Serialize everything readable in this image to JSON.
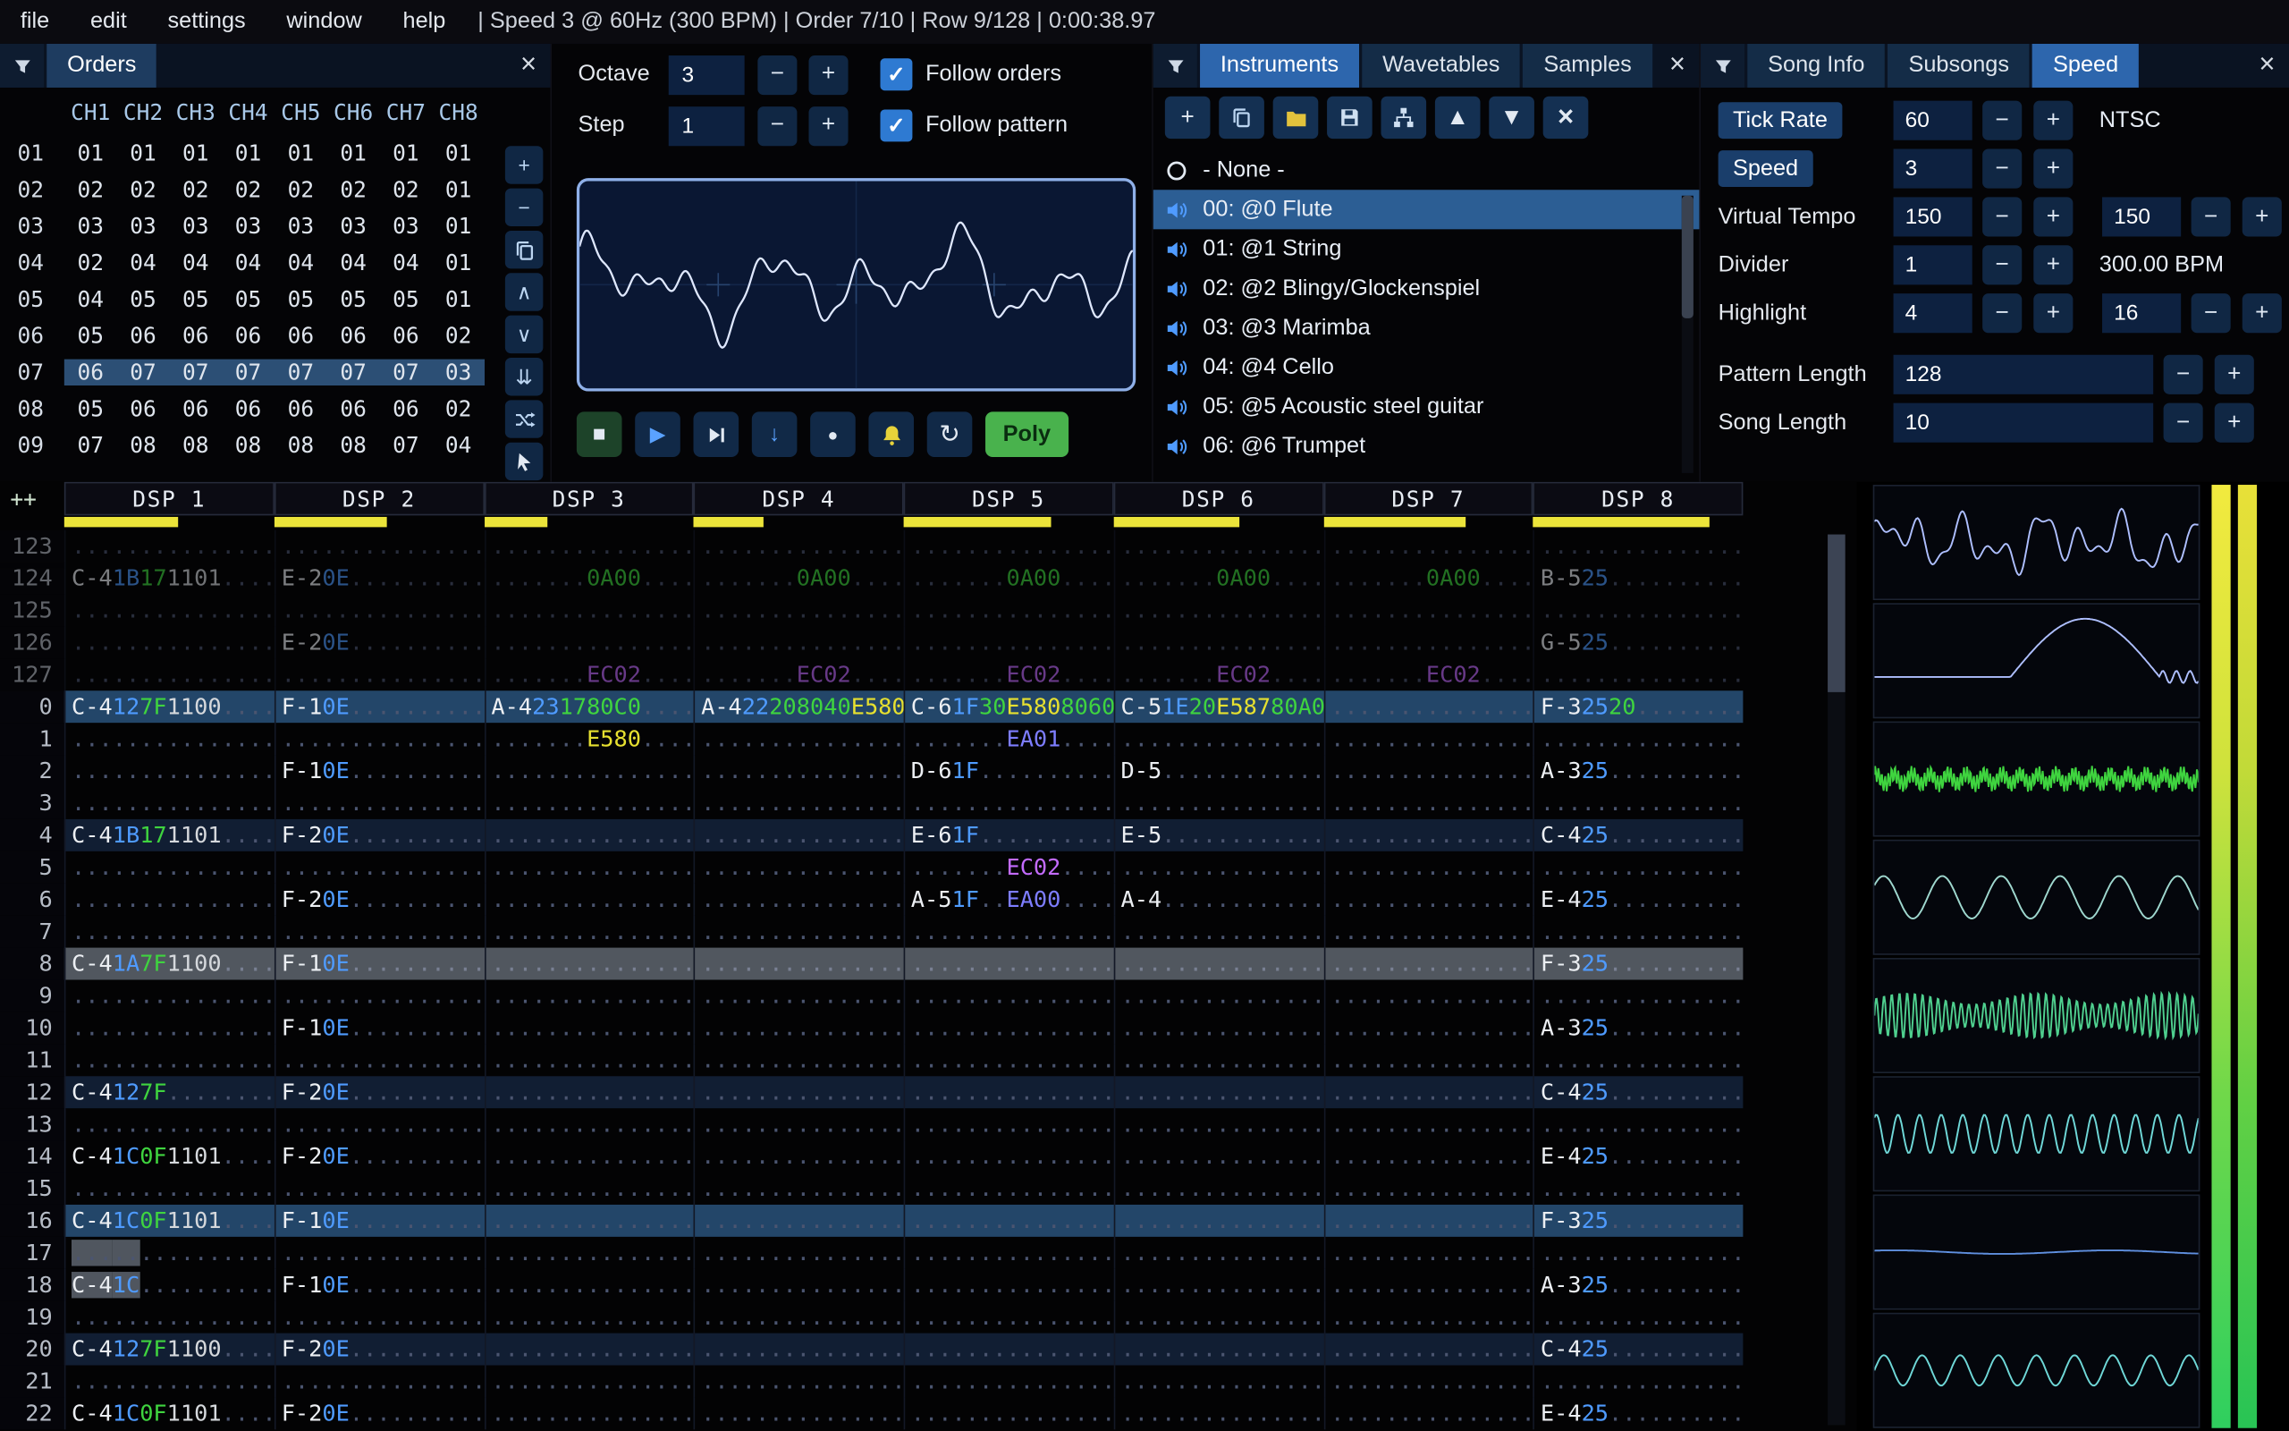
{
  "colors": {
    "accent": "#4f9bff",
    "tab_active": "#2d66ad",
    "note": "#e8e8e8",
    "instrument": "#4f9bff",
    "volume": "#3fd43f",
    "fx_pitch": "#e6e030",
    "fx_misc": "#c36bff",
    "fx_pan": "#3fd43f",
    "fx_legato": "#7d7dff",
    "channel_meter": "#ece43a",
    "highlight_row": "#234669",
    "cursor_row": "#51575f"
  },
  "icons": {
    "plus": "+",
    "minus": "−",
    "chevron-up": "∧",
    "chevron-down": "∨",
    "double-chevron-down": "⇊",
    "triangle-up": "▲",
    "triangle-down": "▼",
    "close": "×",
    "stop": "■",
    "play": "▶",
    "arrow-down": "↓",
    "record": "●",
    "repeat": "↻",
    "check": "✓"
  },
  "menu": {
    "items": [
      "file",
      "edit",
      "settings",
      "window",
      "help"
    ],
    "status": "| Speed 3 @ 60Hz (300 BPM) | Order 7/10 | Row 9/128 | 0:00:38.97"
  },
  "orders": {
    "title": "Orders",
    "channel_headers": [
      "CH1",
      "CH2",
      "CH3",
      "CH4",
      "CH5",
      "CH6",
      "CH7",
      "CH8"
    ],
    "rows": [
      {
        "label": "01",
        "selected": false,
        "values": [
          "01",
          "01",
          "01",
          "01",
          "01",
          "01",
          "01",
          "01"
        ]
      },
      {
        "label": "02",
        "selected": false,
        "values": [
          "02",
          "02",
          "02",
          "02",
          "02",
          "02",
          "02",
          "01"
        ]
      },
      {
        "label": "03",
        "selected": false,
        "values": [
          "03",
          "03",
          "03",
          "03",
          "03",
          "03",
          "03",
          "01"
        ]
      },
      {
        "label": "04",
        "selected": false,
        "values": [
          "02",
          "04",
          "04",
          "04",
          "04",
          "04",
          "04",
          "01"
        ]
      },
      {
        "label": "05",
        "selected": false,
        "values": [
          "04",
          "05",
          "05",
          "05",
          "05",
          "05",
          "05",
          "01"
        ]
      },
      {
        "label": "06",
        "selected": false,
        "values": [
          "05",
          "06",
          "06",
          "06",
          "06",
          "06",
          "06",
          "02"
        ]
      },
      {
        "label": "07",
        "selected": true,
        "values": [
          "06",
          "07",
          "07",
          "07",
          "07",
          "07",
          "07",
          "03"
        ]
      },
      {
        "label": "08",
        "selected": false,
        "values": [
          "05",
          "06",
          "06",
          "06",
          "06",
          "06",
          "06",
          "02"
        ]
      },
      {
        "label": "09",
        "selected": false,
        "values": [
          "07",
          "08",
          "08",
          "08",
          "08",
          "08",
          "07",
          "04"
        ]
      }
    ],
    "toolbar": [
      {
        "name": "add-order-button",
        "icon": "plus"
      },
      {
        "name": "remove-order-button",
        "icon": "minus"
      },
      {
        "name": "duplicate-order-button",
        "icon": "copy"
      },
      {
        "name": "move-order-up-button",
        "icon": "chevron-up"
      },
      {
        "name": "move-order-down-button",
        "icon": "chevron-down"
      },
      {
        "name": "duplicate-order-to-end-button",
        "icon": "double-chevron-down"
      },
      {
        "name": "order-change-mode-button",
        "icon": "shuffle"
      },
      {
        "name": "order-edit-mode-button",
        "icon": "cursor"
      }
    ]
  },
  "transport": {
    "octave_label": "Octave",
    "octave": "3",
    "step_label": "Step",
    "step": "1",
    "follow_orders_label": "Follow orders",
    "follow_pattern_label": "Follow pattern",
    "poly_label": "Poly",
    "buttons": [
      {
        "name": "stop-button",
        "icon": "stop"
      },
      {
        "name": "play-button",
        "icon": "play"
      },
      {
        "name": "play-pattern-button",
        "icon": "next"
      },
      {
        "name": "step-one-row-button",
        "icon": "arrow-down"
      },
      {
        "name": "record-button",
        "icon": "record"
      },
      {
        "name": "metronome-button",
        "icon": "bell"
      },
      {
        "name": "repeat-pattern-button",
        "icon": "repeat"
      }
    ]
  },
  "instruments": {
    "tabs": [
      "Instruments",
      "Wavetables",
      "Samples"
    ],
    "none_label": "- None -",
    "selected": 0,
    "items": [
      "00: @0 Flute",
      "01: @1 String",
      "02: @2 Blingy/Glockenspiel",
      "03: @3 Marimba",
      "04: @4 Cello",
      "05: @5 Acoustic steel guitar",
      "06: @6 Trumpet"
    ],
    "toolbar": [
      {
        "name": "add-instrument-button",
        "icon": "plus"
      },
      {
        "name": "duplicate-instrument-button",
        "icon": "copy"
      },
      {
        "name": "open-instrument-button",
        "icon": "folder"
      },
      {
        "name": "save-instrument-button",
        "icon": "save"
      },
      {
        "name": "instrument-folder-view-button",
        "icon": "tree"
      },
      {
        "name": "move-instrument-up-button",
        "icon": "triangle-up"
      },
      {
        "name": "move-instrument-down-button",
        "icon": "triangle-down"
      },
      {
        "name": "delete-instrument-button",
        "icon": "close"
      }
    ]
  },
  "speed_panel": {
    "tabs": [
      "Song Info",
      "Subsongs",
      "Speed"
    ],
    "tick_rate_label": "Tick Rate",
    "tick_rate": "60",
    "tick_rate_mode": "NTSC",
    "speed_label": "Speed",
    "speed": "3",
    "virtual_tempo_label": "Virtual Tempo",
    "virtual_tempo_numerator": "150",
    "virtual_tempo_denominator": "150",
    "divider_label": "Divider",
    "divider": "1",
    "bpm": "300.00 BPM",
    "highlight_label": "Highlight",
    "highlight_first": "4",
    "highlight_second": "16",
    "pattern_length_label": "Pattern Length",
    "pattern_length": "128",
    "song_length_label": "Song Length",
    "song_length": "10"
  },
  "pattern": {
    "corner": "++",
    "channels": [
      {
        "name": "DSP 1",
        "meter": 0.54
      },
      {
        "name": "DSP 2",
        "meter": 0.54
      },
      {
        "name": "DSP 3",
        "meter": 0.3
      },
      {
        "name": "DSP 4",
        "meter": 0.33
      },
      {
        "name": "DSP 5",
        "meter": 0.7
      },
      {
        "name": "DSP 6",
        "meter": 0.6
      },
      {
        "name": "DSP 7",
        "meter": 0.68
      },
      {
        "name": "DSP 8",
        "meter": 0.84
      }
    ],
    "rows": [
      {
        "n": "123",
        "prev": 1,
        "cells": {}
      },
      {
        "n": "124",
        "prev": 1,
        "cells": {
          "0": [
            "C-4",
            "1B",
            "17",
            "1101|w",
            ""
          ],
          "1": [
            "E-2",
            "0E",
            "",
            "",
            ""
          ],
          "2": [
            "",
            "",
            "",
            "0A00|g",
            ""
          ],
          "3": [
            "",
            "",
            "",
            "0A00|g",
            ""
          ],
          "4": [
            "",
            "",
            "",
            "0A00|g",
            ""
          ],
          "5": [
            "",
            "",
            "",
            "0A00|g",
            ""
          ],
          "6": [
            "",
            "",
            "",
            "0A00|g",
            ""
          ],
          "7": [
            "B-5",
            "25",
            "",
            "",
            ""
          ]
        }
      },
      {
        "n": "125",
        "prev": 1,
        "cells": {}
      },
      {
        "n": "126",
        "prev": 1,
        "cells": {
          "1": [
            "E-2",
            "0E",
            "",
            "",
            ""
          ],
          "7": [
            "G-5",
            "25",
            "",
            "",
            ""
          ]
        }
      },
      {
        "n": "127",
        "prev": 1,
        "cells": {
          "2": [
            "",
            "",
            "",
            "EC02|p",
            ""
          ],
          "3": [
            "",
            "",
            "",
            "EC02|p",
            ""
          ],
          "4": [
            "",
            "",
            "",
            "EC02|p",
            ""
          ],
          "5": [
            "",
            "",
            "",
            "EC02|p",
            ""
          ],
          "6": [
            "",
            "",
            "",
            "EC02|p",
            ""
          ]
        }
      },
      {
        "n": "0",
        "hl": "16",
        "cells": {
          "0": [
            "C-4",
            "12",
            "7F",
            "1100|w",
            ""
          ],
          "1": [
            "F-1",
            "0E",
            "",
            "",
            ""
          ],
          "2": [
            "A-4",
            "23",
            "17",
            "80C0|g",
            ""
          ],
          "3": [
            "A-4",
            "22",
            "20",
            "8040|g",
            "E580|y"
          ],
          "4": [
            "C-6",
            "1F",
            "30",
            "E580|y",
            "8060|g"
          ],
          "5": [
            "C-5",
            "1E",
            "20",
            "E587|y",
            "80A0|g"
          ],
          "7": [
            "F-3",
            "25",
            "20",
            "",
            ""
          ]
        }
      },
      {
        "n": "1",
        "cells": {
          "2": [
            "",
            "",
            "",
            "E580|y",
            ""
          ],
          "4": [
            "",
            "",
            "",
            "EA01|b",
            ""
          ]
        }
      },
      {
        "n": "2",
        "cells": {
          "1": [
            "F-1",
            "0E",
            "",
            "",
            ""
          ],
          "4": [
            "D-6",
            "1F",
            "",
            "",
            ""
          ],
          "5": [
            "D-5",
            "",
            "",
            "",
            ""
          ],
          "7": [
            "A-3",
            "25",
            "",
            "",
            ""
          ]
        }
      },
      {
        "n": "3",
        "cells": {}
      },
      {
        "n": "4",
        "hl": "4",
        "cells": {
          "0": [
            "C-4",
            "1B",
            "17",
            "1101|w",
            ""
          ],
          "1": [
            "F-2",
            "0E",
            "",
            "",
            ""
          ],
          "4": [
            "E-6",
            "1F",
            "",
            "",
            ""
          ],
          "5": [
            "E-5",
            "",
            "",
            "",
            ""
          ],
          "7": [
            "C-4",
            "25",
            "",
            "",
            ""
          ]
        }
      },
      {
        "n": "5",
        "cells": {
          "4": [
            "",
            "",
            "",
            "EC02|p",
            ""
          ]
        }
      },
      {
        "n": "6",
        "cells": {
          "1": [
            "F-2",
            "0E",
            "",
            "",
            ""
          ],
          "4": [
            "A-5",
            "1F",
            "",
            "EA00|b",
            ""
          ],
          "5": [
            "A-4",
            "",
            "",
            "",
            ""
          ],
          "7": [
            "E-4",
            "25",
            "",
            "",
            ""
          ]
        }
      },
      {
        "n": "7",
        "cells": {}
      },
      {
        "n": "8",
        "cur": 1,
        "cells": {
          "0": [
            "C-4",
            "1A",
            "7F",
            "1100|w",
            ""
          ],
          "1": [
            "F-1",
            "0E",
            "",
            "",
            ""
          ],
          "7": [
            "F-3",
            "25",
            "",
            "",
            ""
          ]
        }
      },
      {
        "n": "9",
        "cells": {}
      },
      {
        "n": "10",
        "cells": {
          "1": [
            "F-1",
            "0E",
            "",
            "",
            ""
          ],
          "7": [
            "A-3",
            "25",
            "",
            "",
            ""
          ]
        }
      },
      {
        "n": "11",
        "cells": {}
      },
      {
        "n": "12",
        "hl": "4",
        "cells": {
          "0": [
            "C-4",
            "12",
            "7F",
            "",
            ""
          ],
          "1": [
            "F-2",
            "0E",
            "",
            "",
            ""
          ],
          "7": [
            "C-4",
            "25",
            "",
            "",
            ""
          ]
        }
      },
      {
        "n": "13",
        "cells": {}
      },
      {
        "n": "14",
        "cells": {
          "0": [
            "C-4",
            "1C",
            "0F",
            "1101|w",
            ""
          ],
          "1": [
            "F-2",
            "0E",
            "",
            "",
            ""
          ],
          "7": [
            "E-4",
            "25",
            "",
            "",
            ""
          ]
        }
      },
      {
        "n": "15",
        "cells": {}
      },
      {
        "n": "16",
        "hl": "16",
        "cells": {
          "0": [
            "C-4",
            "1C",
            "0F",
            "1101|w",
            ""
          ],
          "1": [
            "F-1",
            "0E",
            "",
            "",
            ""
          ],
          "7": [
            "F-3",
            "25",
            "",
            "",
            ""
          ]
        }
      },
      {
        "n": "17",
        "sel": [
          0
        ],
        "cells": {}
      },
      {
        "n": "18",
        "sel": [
          0
        ],
        "cells": {
          "0": [
            "C-4",
            "1C",
            "",
            "",
            ""
          ],
          "1": [
            "F-1",
            "0E",
            "",
            "",
            ""
          ],
          "7": [
            "A-3",
            "25",
            "",
            "",
            ""
          ]
        }
      },
      {
        "n": "19",
        "cells": {}
      },
      {
        "n": "20",
        "hl": "4",
        "cells": {
          "0": [
            "C-4",
            "12",
            "7F",
            "1100|w",
            ""
          ],
          "1": [
            "F-2",
            "0E",
            "",
            "",
            ""
          ],
          "7": [
            "C-4",
            "25",
            "",
            "",
            ""
          ]
        }
      },
      {
        "n": "21",
        "cells": {}
      },
      {
        "n": "22",
        "cells": {
          "0": [
            "C-4",
            "1C",
            "0F",
            "1101|w",
            ""
          ],
          "1": [
            "F-2",
            "0E",
            "",
            "",
            ""
          ],
          "7": [
            "E-4",
            "25",
            "",
            "",
            ""
          ]
        }
      }
    ]
  },
  "oscilloscope": {
    "color": "#dfe8ff"
  },
  "scopes": [
    {
      "name": "channel-1-scope",
      "channel": "DSP 1",
      "type": "wobble",
      "color": "#aebfff"
    },
    {
      "name": "channel-2-scope",
      "channel": "DSP 2",
      "type": "ramp",
      "color": "#aebfff"
    },
    {
      "name": "channel-3-scope",
      "channel": "DSP 3",
      "type": "dense",
      "color": "#3fd43f"
    },
    {
      "name": "channel-4-scope",
      "channel": "DSP 4",
      "type": "sine",
      "color": "#9fd8cf"
    },
    {
      "name": "channel-5-scope",
      "channel": "DSP 5",
      "type": "dense2",
      "color": "#4fd08f"
    },
    {
      "name": "channel-6-scope",
      "channel": "DSP 6",
      "type": "zigzag",
      "color": "#6fd8d8"
    },
    {
      "name": "channel-7-scope",
      "channel": "DSP 7",
      "type": "flat",
      "color": "#5f8fdf"
    },
    {
      "name": "channel-8-scope",
      "channel": "DSP 8",
      "type": "sine2",
      "color": "#6fd8d8"
    }
  ],
  "meters": [
    {
      "name": "master-volume-meter-left"
    },
    {
      "name": "master-volume-meter-right"
    }
  ]
}
